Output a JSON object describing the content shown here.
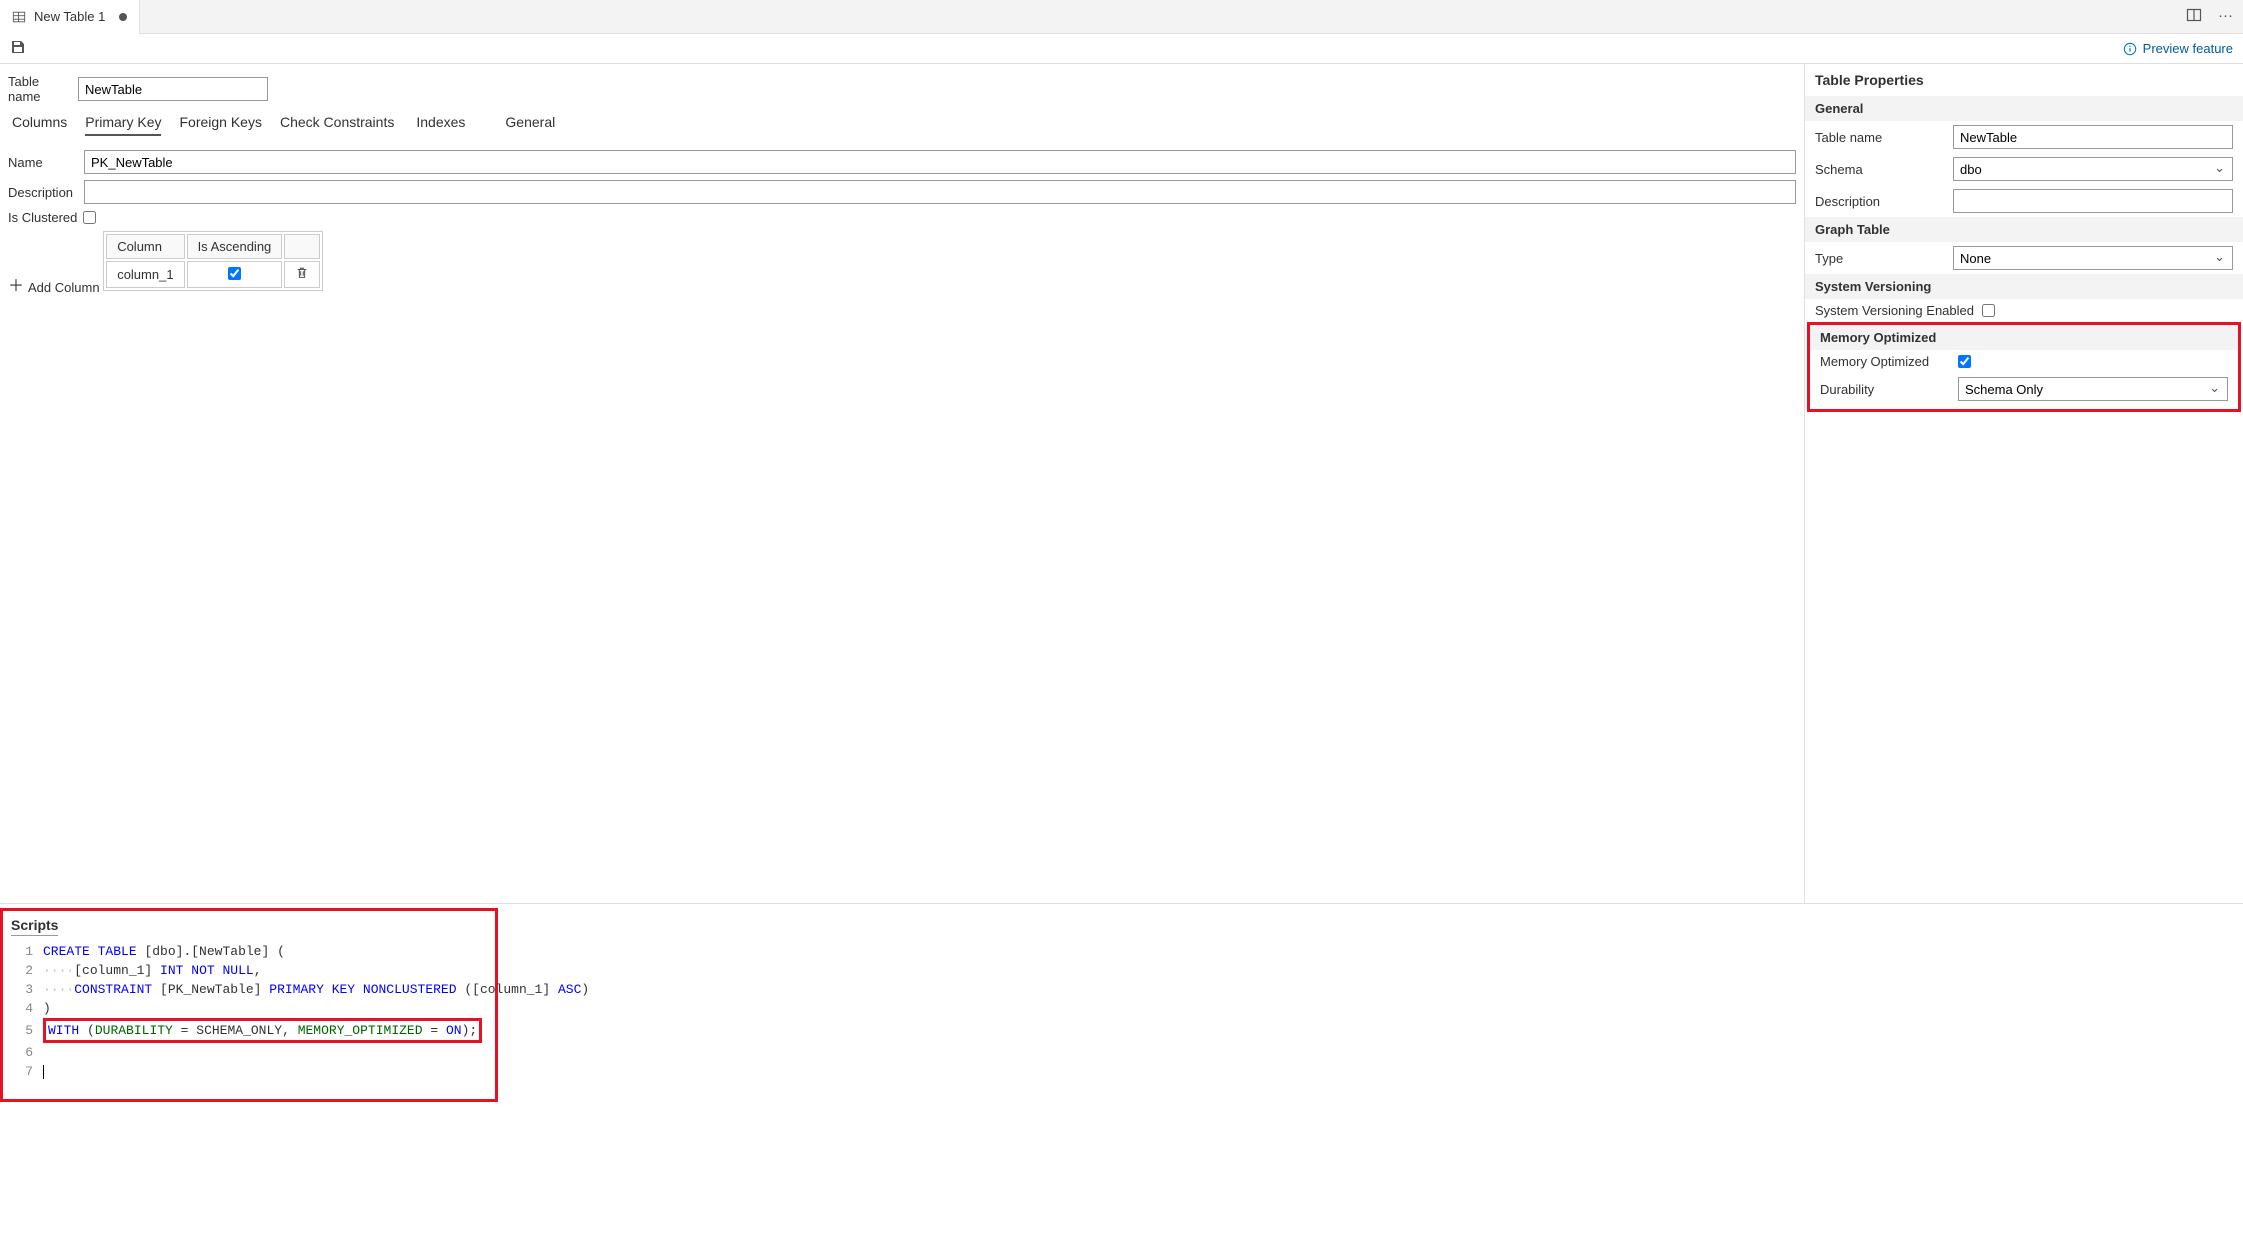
{
  "tab": {
    "title": "New Table 1"
  },
  "toolbar": {
    "preview": "Preview feature"
  },
  "form": {
    "table_name_label": "Table name",
    "table_name_value": "NewTable"
  },
  "sub_tabs": {
    "columns": "Columns",
    "primary_key": "Primary Key",
    "foreign_keys": "Foreign Keys",
    "check_constraints": "Check Constraints",
    "indexes": "Indexes",
    "general": "General"
  },
  "pk": {
    "name_label": "Name",
    "name_value": "PK_NewTable",
    "description_label": "Description",
    "description_value": "",
    "is_clustered_label": "Is Clustered",
    "add_column": "Add Column",
    "grid": {
      "col_hdr": "Column",
      "asc_hdr": "Is Ascending",
      "row_col": "column_1"
    }
  },
  "props": {
    "title": "Table Properties",
    "general_hdr": "General",
    "table_name_label": "Table name",
    "table_name_value": "NewTable",
    "schema_label": "Schema",
    "schema_value": "dbo",
    "description_label": "Description",
    "description_value": "",
    "graph_hdr": "Graph Table",
    "type_label": "Type",
    "type_value": "None",
    "sysver_hdr": "System Versioning",
    "sysver_enabled_label": "System Versioning Enabled",
    "memopt_hdr": "Memory Optimized",
    "memopt_label": "Memory Optimized",
    "durability_label": "Durability",
    "durability_value": "Schema Only"
  },
  "scripts": {
    "title": "Scripts",
    "lines": {
      "l1a": "CREATE",
      "l1b": "TABLE",
      "l1c": "[dbo].[NewTable] (",
      "l2a": "[column_1] ",
      "l2b": "INT",
      "l2c": "NOT",
      "l2d": "NULL",
      "l2e": ",",
      "l3a": "CONSTRAINT",
      "l3b": "[PK_NewTable] ",
      "l3c": "PRIMARY",
      "l3d": "KEY",
      "l3e": "NONCLUSTERED",
      "l3f": "([column_1] ",
      "l3g": "ASC",
      "l3h": ")",
      "l4": ")",
      "l5a": "WITH",
      "l5b": "(",
      "l5c": "DURABILITY",
      "l5d": "= SCHEMA_ONLY, ",
      "l5e": "MEMORY_OPTIMIZED",
      "l5f": "= ",
      "l5g": "ON",
      "l5h": ");"
    }
  }
}
